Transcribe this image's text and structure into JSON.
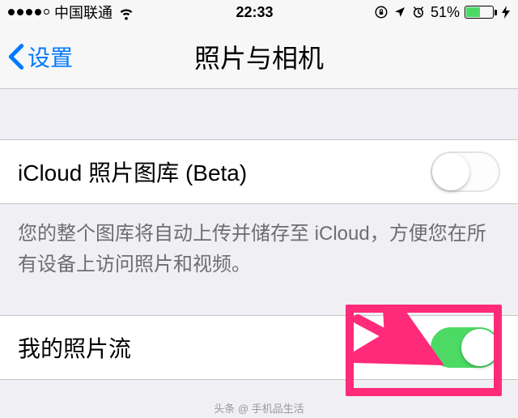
{
  "status": {
    "carrier": "中国联通",
    "time": "22:33",
    "battery_pct": "51%"
  },
  "nav": {
    "back_label": "设置",
    "title": "照片与相机"
  },
  "rows": {
    "icloud_library": "iCloud 照片图库 (Beta)",
    "my_photo_stream": "我的照片流"
  },
  "footer": {
    "icloud_desc": "您的整个图库将自动上传并储存至 iCloud，方便您在所有设备上访问照片和视频。"
  },
  "watermark": "头条 @ 手机品生活",
  "colors": {
    "tint": "#007aff",
    "switch_on": "#4cd964",
    "highlight": "#ff2a7a"
  }
}
